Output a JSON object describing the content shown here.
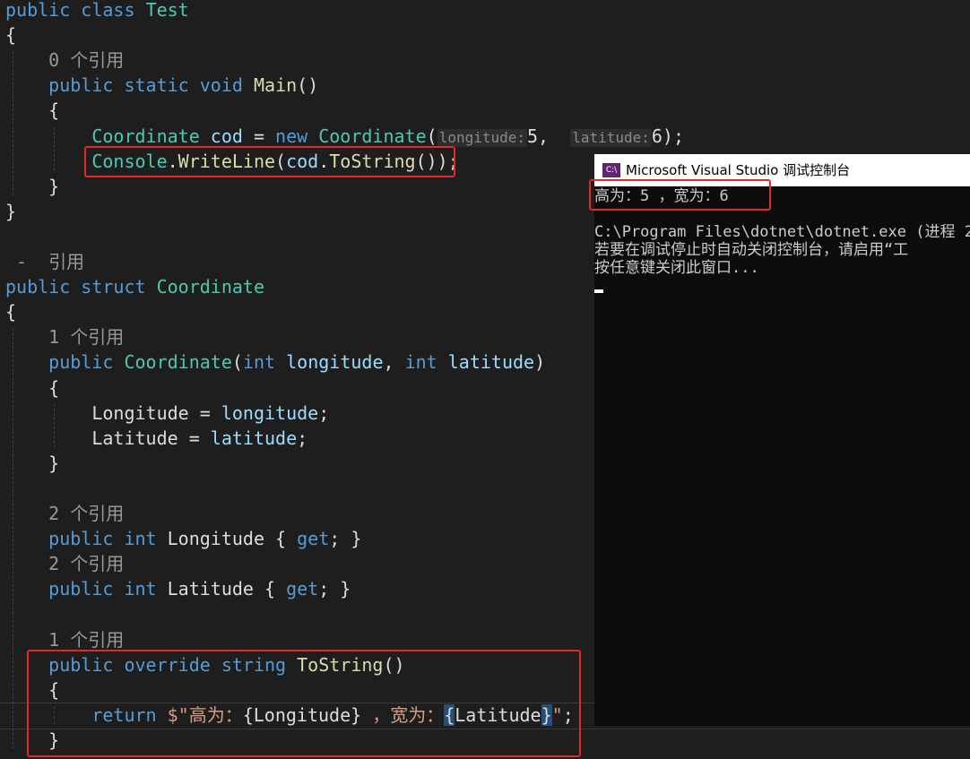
{
  "editor": {
    "lines": [
      [
        {
          "c": "kw",
          "t": "public"
        },
        {
          "c": "pl",
          "t": " "
        },
        {
          "c": "kw",
          "t": "class"
        },
        {
          "c": "pl",
          "t": " "
        },
        {
          "c": "ty",
          "t": "Test"
        }
      ],
      [
        {
          "c": "pl",
          "t": "{"
        }
      ],
      [
        {
          "c": "lens",
          "t": "    0 个引用"
        }
      ],
      [
        {
          "c": "pl",
          "t": "    "
        },
        {
          "c": "kw",
          "t": "public"
        },
        {
          "c": "pl",
          "t": " "
        },
        {
          "c": "kw",
          "t": "static"
        },
        {
          "c": "pl",
          "t": " "
        },
        {
          "c": "kw",
          "t": "void"
        },
        {
          "c": "pl",
          "t": " "
        },
        {
          "c": "fn",
          "t": "Main"
        },
        {
          "c": "pl",
          "t": "()"
        }
      ],
      [
        {
          "c": "pl",
          "t": "    {"
        }
      ],
      [
        {
          "c": "pl",
          "t": "        "
        },
        {
          "c": "ty",
          "t": "Coordinate"
        },
        {
          "c": "pl",
          "t": " "
        },
        {
          "c": "pm",
          "t": "cod"
        },
        {
          "c": "pl",
          "t": " = "
        },
        {
          "c": "kw",
          "t": "new"
        },
        {
          "c": "pl",
          "t": " "
        },
        {
          "c": "ty",
          "t": "Coordinate"
        },
        {
          "c": "pl",
          "t": "("
        },
        {
          "c": "hint",
          "t": "longitude:"
        },
        {
          "c": "pl",
          "t": "5,  "
        },
        {
          "c": "hint",
          "t": "latitude:"
        },
        {
          "c": "pl",
          "t": "6);"
        }
      ],
      [
        {
          "c": "pl",
          "t": "        "
        },
        {
          "c": "ty",
          "t": "Console"
        },
        {
          "c": "pl",
          "t": "."
        },
        {
          "c": "fn",
          "t": "WriteLine"
        },
        {
          "c": "pl",
          "t": "("
        },
        {
          "c": "pm",
          "t": "cod"
        },
        {
          "c": "pl",
          "t": "."
        },
        {
          "c": "fn",
          "t": "ToString"
        },
        {
          "c": "pl",
          "t": "());"
        }
      ],
      [
        {
          "c": "pl",
          "t": "    }"
        }
      ],
      [
        {
          "c": "pl",
          "t": "}"
        }
      ],
      [],
      [
        {
          "c": "lens",
          "t": " -  引用"
        }
      ],
      [
        {
          "c": "kw",
          "t": "public"
        },
        {
          "c": "pl",
          "t": " "
        },
        {
          "c": "kw",
          "t": "struct"
        },
        {
          "c": "pl",
          "t": " "
        },
        {
          "c": "ty",
          "t": "Coordinate"
        }
      ],
      [
        {
          "c": "pl",
          "t": "{"
        }
      ],
      [
        {
          "c": "lens",
          "t": "    1 个引用"
        }
      ],
      [
        {
          "c": "pl",
          "t": "    "
        },
        {
          "c": "kw",
          "t": "public"
        },
        {
          "c": "pl",
          "t": " "
        },
        {
          "c": "ty",
          "t": "Coordinate"
        },
        {
          "c": "pl",
          "t": "("
        },
        {
          "c": "kw",
          "t": "int"
        },
        {
          "c": "pl",
          "t": " "
        },
        {
          "c": "pm",
          "t": "longitude"
        },
        {
          "c": "pl",
          "t": ", "
        },
        {
          "c": "kw",
          "t": "int"
        },
        {
          "c": "pl",
          "t": " "
        },
        {
          "c": "pm",
          "t": "latitude"
        },
        {
          "c": "pl",
          "t": ")"
        }
      ],
      [
        {
          "c": "pl",
          "t": "    {"
        }
      ],
      [
        {
          "c": "pl",
          "t": "        Longitude = "
        },
        {
          "c": "pm",
          "t": "longitude"
        },
        {
          "c": "pl",
          "t": ";"
        }
      ],
      [
        {
          "c": "pl",
          "t": "        Latitude = "
        },
        {
          "c": "pm",
          "t": "latitude"
        },
        {
          "c": "pl",
          "t": ";"
        }
      ],
      [
        {
          "c": "pl",
          "t": "    }"
        }
      ],
      [],
      [
        {
          "c": "lens",
          "t": "    2 个引用"
        }
      ],
      [
        {
          "c": "pl",
          "t": "    "
        },
        {
          "c": "kw",
          "t": "public"
        },
        {
          "c": "pl",
          "t": " "
        },
        {
          "c": "kw",
          "t": "int"
        },
        {
          "c": "pl",
          "t": " Longitude { "
        },
        {
          "c": "kw",
          "t": "get"
        },
        {
          "c": "pl",
          "t": "; }"
        }
      ],
      [
        {
          "c": "lens",
          "t": "    2 个引用"
        }
      ],
      [
        {
          "c": "pl",
          "t": "    "
        },
        {
          "c": "kw",
          "t": "public"
        },
        {
          "c": "pl",
          "t": " "
        },
        {
          "c": "kw",
          "t": "int"
        },
        {
          "c": "pl",
          "t": " Latitude { "
        },
        {
          "c": "kw",
          "t": "get"
        },
        {
          "c": "pl",
          "t": "; }"
        }
      ],
      [],
      [
        {
          "c": "lens",
          "t": "    1 个引用"
        }
      ],
      [
        {
          "c": "pl",
          "t": "    "
        },
        {
          "c": "kw",
          "t": "public"
        },
        {
          "c": "pl",
          "t": " "
        },
        {
          "c": "kw",
          "t": "override"
        },
        {
          "c": "pl",
          "t": " "
        },
        {
          "c": "kw",
          "t": "string"
        },
        {
          "c": "pl",
          "t": " "
        },
        {
          "c": "fn",
          "t": "ToString"
        },
        {
          "c": "pl",
          "t": "()"
        }
      ],
      [
        {
          "c": "pl",
          "t": "    {"
        }
      ],
      [
        {
          "c": "pl",
          "t": "        "
        },
        {
          "c": "kw",
          "t": "return"
        },
        {
          "c": "pl",
          "t": " "
        },
        {
          "c": "st",
          "t": "$\"高为："
        },
        {
          "c": "pl",
          "t": "{Longitude}"
        },
        {
          "c": "st",
          "t": " ，宽为："
        },
        {
          "c": "hlp",
          "t": "{"
        },
        {
          "c": "pl",
          "t": "Latitude"
        },
        {
          "c": "hlp",
          "t": "}"
        },
        {
          "c": "st",
          "t": "\""
        },
        {
          "c": "pl",
          "t": ";"
        }
      ],
      [
        {
          "c": "pl",
          "t": "    }"
        }
      ]
    ]
  },
  "console": {
    "title": "Microsoft Visual Studio 调试控制台",
    "icon_text": "C:\\",
    "lines": [
      "高为：5 ，宽为：6",
      "",
      "C:\\Program Files\\dotnet\\dotnet.exe (进程 2",
      "若要在调试停止时自动关闭控制台，请启用“工",
      "按任意键关闭此窗口..."
    ]
  }
}
